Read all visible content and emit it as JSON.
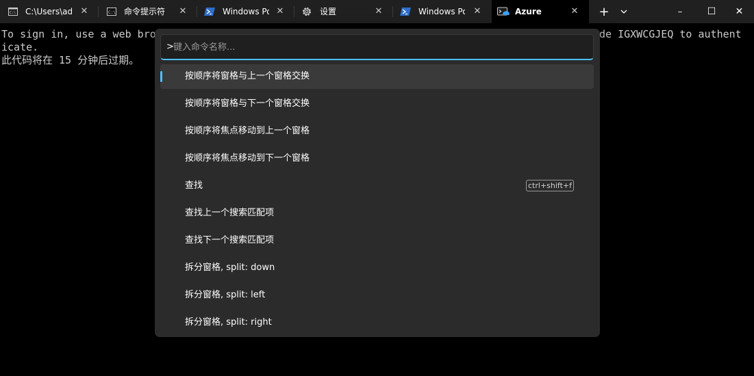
{
  "tabs": [
    {
      "label": "C:\\Users\\adr",
      "icon": "cmd-small-icon",
      "active": false
    },
    {
      "label": "命令提示符",
      "icon": "cmd-icon",
      "active": false
    },
    {
      "label": "Windows Po",
      "icon": "powershell-icon",
      "active": false
    },
    {
      "label": "设置",
      "icon": "gear-icon",
      "active": false
    },
    {
      "label": "Windows Po",
      "icon": "powershell-icon",
      "active": false
    },
    {
      "label": "Azure",
      "icon": "azure-cloud-shell-icon",
      "active": true
    }
  ],
  "tabbar": {
    "new_tab": "+",
    "dropdown": "⌄",
    "minimize": "–",
    "maximize": "☐",
    "close": "✕",
    "tab_close": "✕"
  },
  "terminal": {
    "line1_left": "To sign in, use a web bro",
    "line1_right": "de IGXWCGJEQ to authent",
    "line2": "icate.",
    "line3": "此代码将在 15 分钟后过期。"
  },
  "palette": {
    "prefix": ">",
    "placeholder": "键入命令名称...",
    "value": "",
    "accent": "#4cc2ff",
    "commands": [
      {
        "label": "按顺序将窗格与上一个窗格交换",
        "shortcut": "",
        "selected": true
      },
      {
        "label": "按顺序将窗格与下一个窗格交换",
        "shortcut": ""
      },
      {
        "label": "按顺序将焦点移动到上一个窗格",
        "shortcut": ""
      },
      {
        "label": "按顺序将焦点移动到下一个窗格",
        "shortcut": ""
      },
      {
        "label": "查找",
        "shortcut": "ctrl+shift+f"
      },
      {
        "label": "查找上一个搜索匹配项",
        "shortcut": ""
      },
      {
        "label": "查找下一个搜索匹配项",
        "shortcut": ""
      },
      {
        "label": "拆分窗格, split: down",
        "shortcut": ""
      },
      {
        "label": "拆分窗格, split: left",
        "shortcut": ""
      },
      {
        "label": "拆分窗格, split: right",
        "shortcut": ""
      }
    ]
  }
}
